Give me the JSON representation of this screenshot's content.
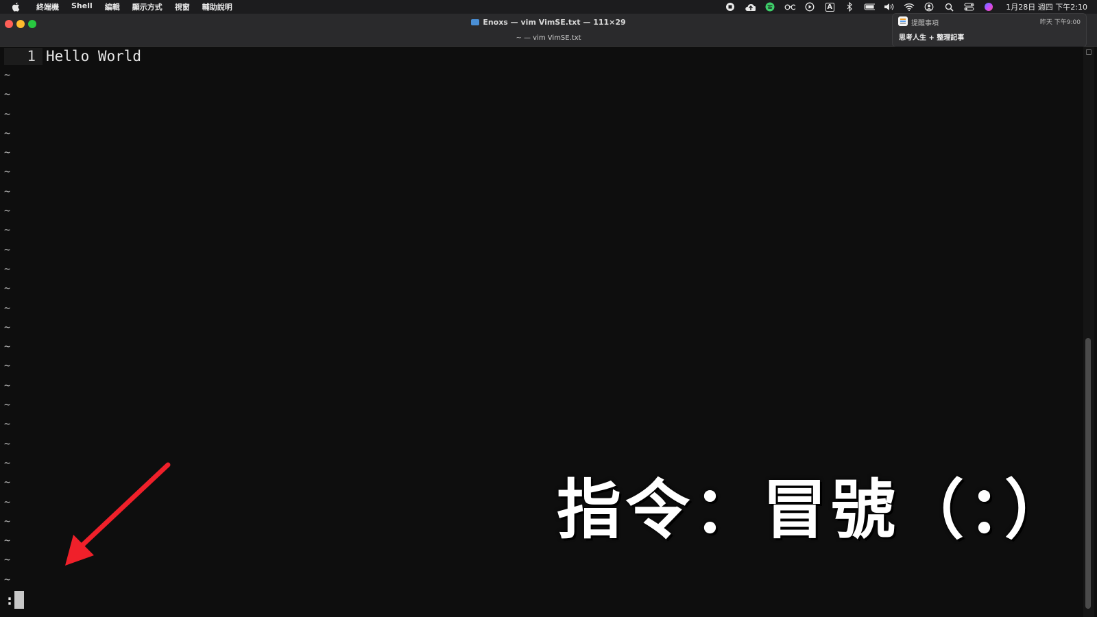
{
  "menubar": {
    "items": [
      "終端機",
      "Shell",
      "編輯",
      "顯示方式",
      "視窗",
      "輔助說明"
    ],
    "clock": "1月28日 週四 下午2:10",
    "status_icons": [
      "record-icon",
      "cloud-upload-icon",
      "spotify-icon",
      "glasses-icon",
      "play-icon",
      "input-method-icon",
      "bluetooth-icon",
      "battery-icon",
      "volume-icon",
      "wifi-icon",
      "user-icon",
      "search-icon",
      "control-center-icon",
      "siri-icon"
    ],
    "input_method_label": "A"
  },
  "window": {
    "title": "Enoxs — vim VimSE.txt — 111×29",
    "tab_title": "~ — vim VimSE.txt"
  },
  "notification": {
    "app": "提醒事項",
    "time": "昨天 下午9:00",
    "body": "思考人生 + 整理記事"
  },
  "editor": {
    "line_number": "1",
    "line_text": "Hello World",
    "tilde": "~",
    "tilde_count": 27,
    "command_prompt": ":"
  },
  "overlay": {
    "caption": "指令：冒號（：）",
    "arrow_color": "#f0202a"
  }
}
